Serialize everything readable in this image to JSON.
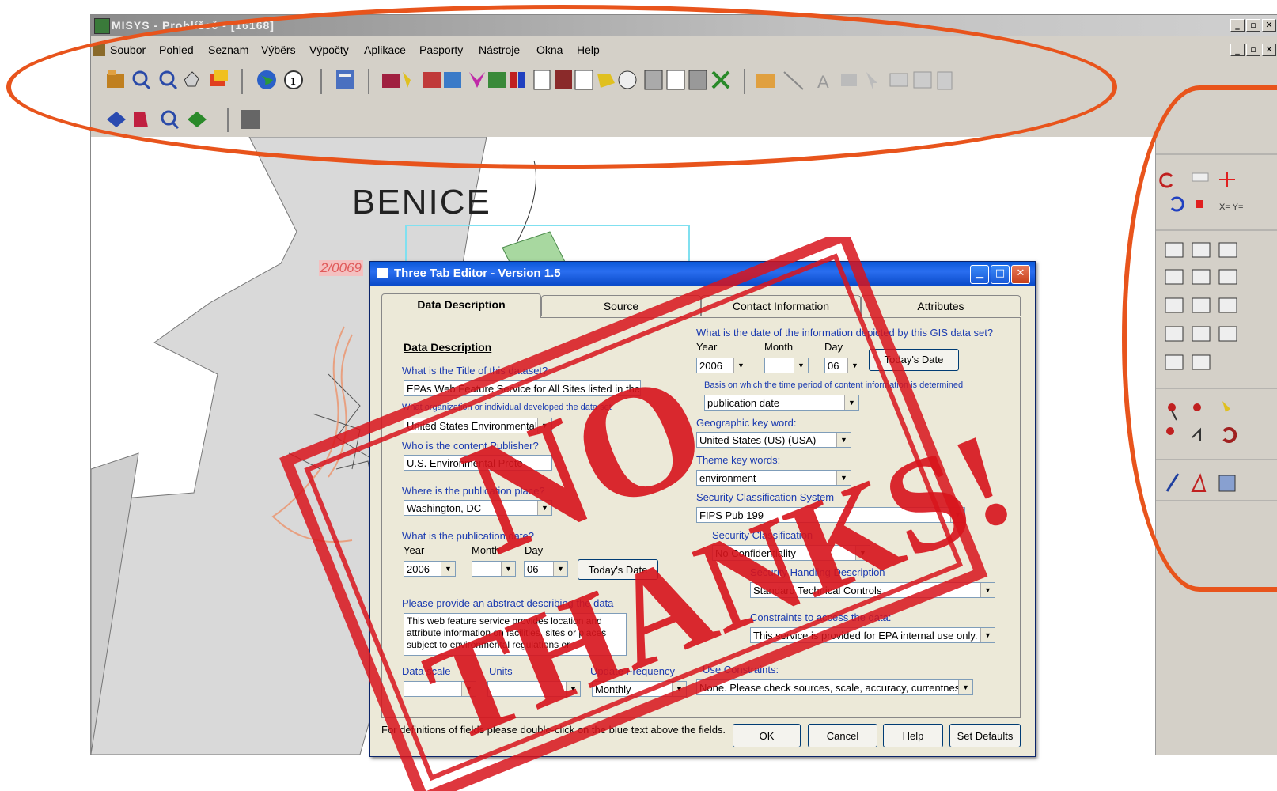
{
  "app": {
    "title": "MISYS - Prohlížeč - [16168]",
    "menu": [
      "Soubor",
      "Pohled",
      "Seznam",
      "Výběrs",
      "Výpočty",
      "Aplikace",
      "Pasporty",
      "Nástroje",
      "Okna",
      "Help"
    ],
    "window_controls": [
      "_",
      "▫",
      "✕"
    ]
  },
  "map": {
    "place_label": "BENICE",
    "parcel_label": "2/0069"
  },
  "dialog": {
    "title": "Three Tab Editor - Version 1.5",
    "tabs": [
      "Data Description",
      "Source",
      "Contact Information",
      "Attributes"
    ],
    "section_heading": "Data Description",
    "q_title": "What is the Title of this dataset?",
    "v_title": "EPAs Web Feature Service for All Sites listed in the",
    "q_org": "What organization or individual developed the data set",
    "v_org": "United States Environmental",
    "q_publisher": "Who is the content Publisher?",
    "v_publisher": "U.S. Environmental Prote",
    "q_place": "Where is the publication place?",
    "v_place": "Washington, DC",
    "q_pubdate": "What is the publication date?",
    "year_label": "Year",
    "month_label": "Month",
    "day_label": "Day",
    "pub_year": "2006",
    "pub_month": "",
    "pub_day": "06",
    "todays_date_btn": "Today's Date",
    "q_abstract": "Please provide an abstract describing the data",
    "abstract": "This web feature service provides location and attribute information on facilities, sites or places subject to environmental regulations or",
    "q_scale": "Data scale",
    "q_units": "Units",
    "q_update": "Update Frequency",
    "v_update": "Monthly",
    "q_infodate": "What is the date of the information depicted by this GIS data set?",
    "info_year": "2006",
    "info_month": "",
    "info_day": "06",
    "todays_date_btn2": "Today's Date",
    "q_basis": "Basis on which the time period of content information is determined",
    "v_basis": "publication date",
    "q_geo_kw": "Geographic key word:",
    "v_geo_kw": "United States (US) (USA)",
    "q_theme_kw": "Theme key words:",
    "v_theme_kw": "environment",
    "q_security_system": "Security Classification System",
    "v_security_system": "FIPS Pub 199",
    "q_security_class": "Security Classification",
    "v_security_class": "No Confidentiality",
    "q_security_handling": "Security Handling Description",
    "v_security_handling": "Standard Technical Controls",
    "q_access": "Constraints to access the data:",
    "v_access": "This service is provided for EPA internal use only. A",
    "q_use": "Use Constraints:",
    "v_use": "None. Please check sources, scale, accuracy, currentnes",
    "footer_note": "For definitions of fields please double-click on the blue text above the fields.",
    "buttons": [
      "OK",
      "Cancel",
      "Help",
      "Set Defaults"
    ]
  },
  "stamp": {
    "line1": "NO",
    "line2": "THANKS!",
    "color": "#d8141c"
  },
  "colors": {
    "highlight_ring": "#e8541c",
    "dialog_title": "#0a58d8"
  }
}
